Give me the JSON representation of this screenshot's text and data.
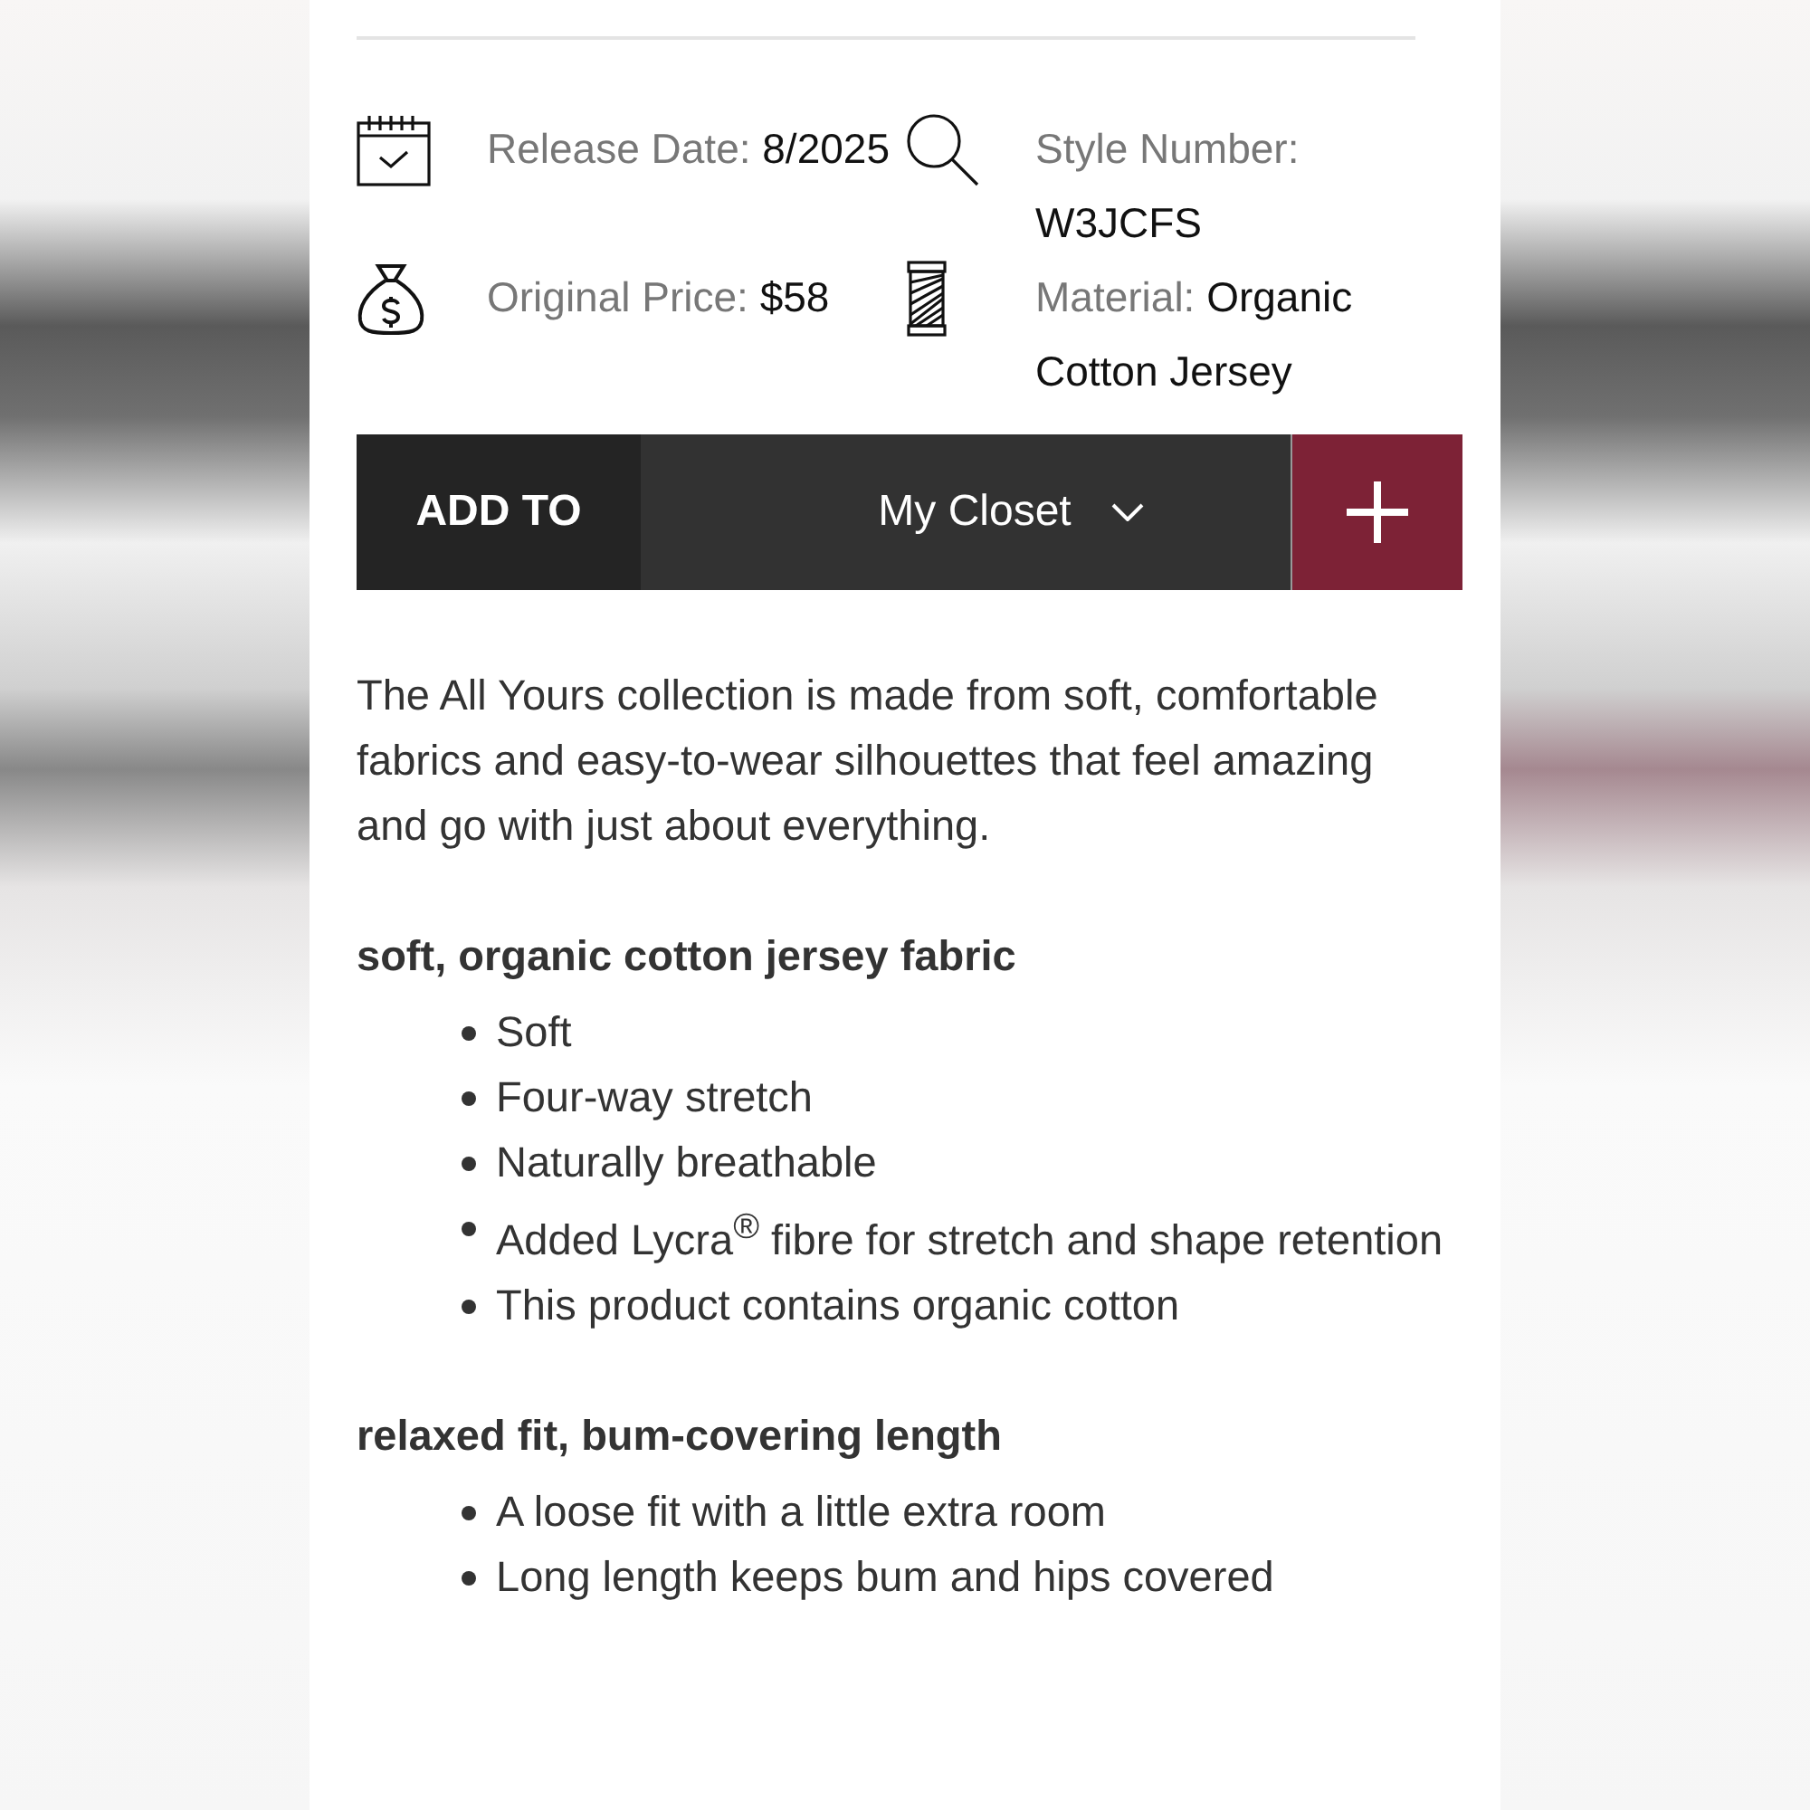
{
  "details": [
    {
      "kind": "date",
      "label": "Release Date:",
      "value": "8/2025"
    },
    {
      "kind": "style",
      "label": "Style Number:",
      "value": "W3JCFS"
    },
    {
      "kind": "price",
      "label": "Original Price:",
      "value": "$58"
    },
    {
      "kind": "material",
      "label": "Material:",
      "value": "Organic Cotton Jersey"
    }
  ],
  "add_bar": {
    "label": "ADD TO",
    "dropdown": "My Closet"
  },
  "description": "The All Yours collection is made from soft, comfortable fabrics and easy-to-wear silhouettes that feel amazing and go with just about everything.",
  "sections": [
    {
      "heading": "soft, organic cotton jersey fabric",
      "bullets": [
        "Soft",
        "Four-way stretch",
        "Naturally breathable",
        "Added Lycra$^{®}$ fibre for stretch and shape retention",
        "This product contains organic cotton"
      ]
    },
    {
      "heading": "relaxed fit, bum-covering length",
      "bullets": [
        "A loose fit with a little extra room",
        "Long length keeps bum and hips covered"
      ]
    }
  ]
}
